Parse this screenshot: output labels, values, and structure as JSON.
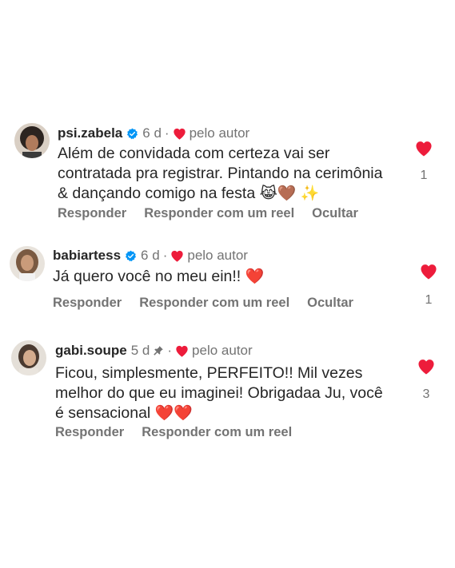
{
  "comments": [
    {
      "username": "psi.zabela",
      "time": "6 d",
      "separator": "·",
      "liked_by": "pelo autor",
      "text_lines": [
        "Além de convidada com certeza vai ser",
        "contratada pra registrar. Pintando na cerimônia",
        "& dançando comigo na festa"
      ],
      "emojis": "😹🤎 ✨",
      "actions": [
        "Responder",
        "Responder com um reel",
        "Ocultar"
      ],
      "like_count": "1"
    },
    {
      "username": "babiartess",
      "time": "6 d",
      "separator": "·",
      "liked_by": "pelo autor",
      "text_lines": [
        "Já quero você no meu ein!!"
      ],
      "emojis": "❤️",
      "actions": [
        "Responder",
        "Responder com um reel",
        "Ocultar"
      ],
      "like_count": "1"
    },
    {
      "username": "gabi.soupe",
      "time": "5 d",
      "separator": "·",
      "liked_by": "pelo autor",
      "text_lines": [
        "Ficou, simplesmente, PERFEITO!! Mil vezes",
        "melhor do que eu imaginei! Obrigadaa Ju, você",
        "é sensacional"
      ],
      "emojis": "❤️❤️",
      "actions": [
        "Responder",
        "Responder com um reel"
      ],
      "like_count": "3"
    }
  ],
  "colors": {
    "like": "#ed1c3b",
    "verified": "#0095f6",
    "muted": "#737373"
  }
}
